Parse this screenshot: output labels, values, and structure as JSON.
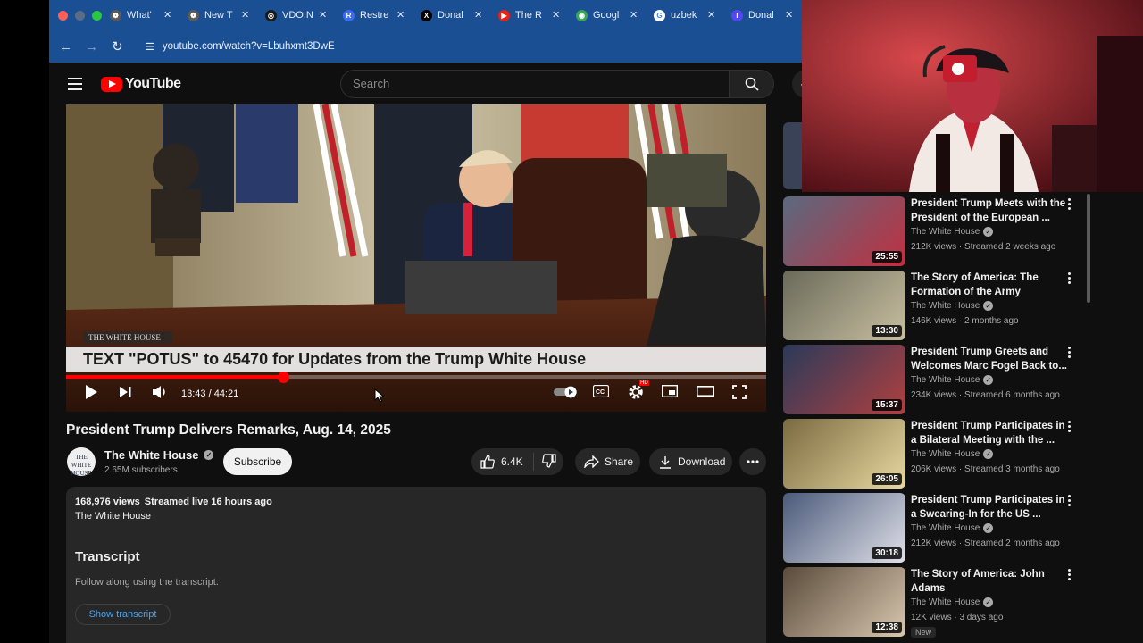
{
  "browser": {
    "tabs": [
      {
        "title": "What'",
        "icon": "chatgpt-icon",
        "bg": "#5a5a5a"
      },
      {
        "title": "New T",
        "icon": "chatgpt-icon",
        "bg": "#5a5a5a"
      },
      {
        "title": "VDO.N",
        "icon": "vdo-ninja-icon",
        "bg": "#1a1a1a"
      },
      {
        "title": "Restre",
        "icon": "restream-icon",
        "bg": "#3b6cf0"
      },
      {
        "title": "Donal",
        "icon": "x-icon",
        "bg": "#000000"
      },
      {
        "title": "The R",
        "icon": "youtube-icon",
        "bg": "#e62117"
      },
      {
        "title": "Googl",
        "icon": "google-maps-icon",
        "bg": "#34a853"
      },
      {
        "title": "uzbek",
        "icon": "google-icon",
        "bg": "#ffffff"
      },
      {
        "title": "Donal",
        "icon": "truth-social-icon",
        "bg": "#5448ee"
      }
    ],
    "url": "youtube.com/watch?v=Lbuhxmt3DwE"
  },
  "youtube": {
    "logo_text": "YouTube",
    "search_placeholder": "Search"
  },
  "video": {
    "banner_text": "TEXT \"POTUS\" to 45470 for Updates from the Trump White House",
    "watermark": "THE WHITE HOUSE",
    "time": "13:43 / 44:21",
    "progress_fraction": 0.31,
    "title": "President Trump Delivers Remarks, Aug. 14, 2025"
  },
  "channel": {
    "name": "The White House",
    "avatar_text": "THE WHITE HOUSE",
    "subscribers": "2.65M subscribers",
    "subscribe_label": "Subscribe"
  },
  "actions": {
    "likes": "6.4K",
    "share": "Share",
    "download": "Download"
  },
  "description": {
    "views": "168,976 views",
    "streamed": "Streamed live 16 hours ago",
    "owner": "The White House",
    "transcript_heading": "Transcript",
    "transcript_sub": "Follow along using the transcript.",
    "transcript_button": "Show transcript"
  },
  "recommendations": [
    {
      "title": "President Trump Meets with the President of the European ...",
      "channel": "The White House",
      "meta": "212K views · Streamed 2 weeks ago",
      "duration": "25:55",
      "new": ""
    },
    {
      "title": "The Story of America: The Formation of the Army",
      "channel": "The White House",
      "meta": "146K views · 2 months ago",
      "duration": "13:30",
      "new": ""
    },
    {
      "title": "President Trump Greets and Welcomes Marc Fogel Back to...",
      "channel": "The White House",
      "meta": "234K views · Streamed 6 months ago",
      "duration": "15:37",
      "new": ""
    },
    {
      "title": "President Trump Participates in a Bilateral Meeting with the ...",
      "channel": "The White House",
      "meta": "206K views · Streamed 3 months ago",
      "duration": "26:05",
      "new": ""
    },
    {
      "title": "President Trump Participates in a Swearing-In for the US ...",
      "channel": "The White House",
      "meta": "212K views · Streamed 2 months ago",
      "duration": "30:18",
      "new": ""
    },
    {
      "title": "The Story of America: John Adams",
      "channel": "The White House",
      "meta": "12K views · 3 days ago",
      "duration": "12:38",
      "new": "New"
    }
  ]
}
